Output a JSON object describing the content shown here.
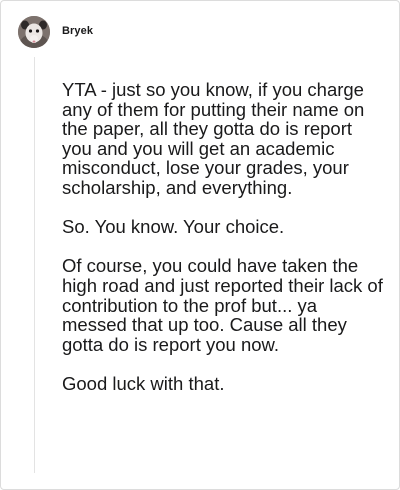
{
  "comment": {
    "author": "Bryek",
    "avatar_icon": "possum-avatar-icon",
    "paragraphs": [
      "YTA - just so you know, if you charge any of them for putting their name on the paper, all they gotta do is report you and you will get an academic misconduct, lose your grades, your scholarship, and everything.",
      "So. You know. Your choice.",
      "Of course, you could have taken the high road and just reported their lack of contribution to the prof but... ya messed that up too. Cause all they gotta do is report you now.",
      "Good luck with that."
    ]
  }
}
